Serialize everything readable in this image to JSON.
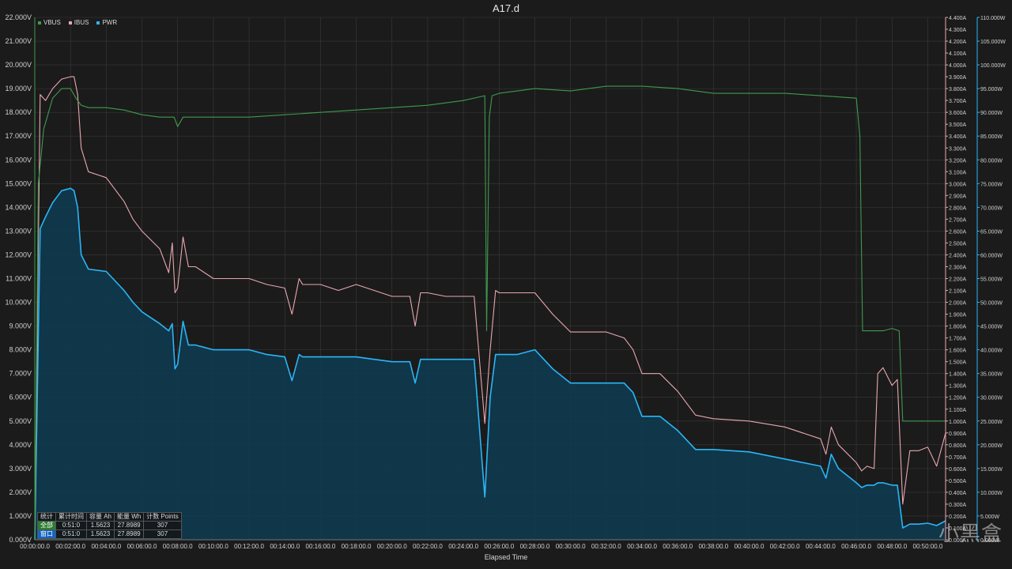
{
  "chart_data": {
    "type": "line",
    "title": "A17.d",
    "xlabel": "Elapsed Time",
    "x_unit": "minutes",
    "xlim": [
      0,
      51
    ],
    "x_tick_labels": [
      "00:00:00.0",
      "00:02:00.0",
      "00:04:00.0",
      "00:06:00.0",
      "00:08:00.0",
      "00:10:00.0",
      "00:12:00.0",
      "00:14:00.0",
      "00:16:00.0",
      "00:18:00.0",
      "00:20:00.0",
      "00:22:00.0",
      "00:24:00.0",
      "00:26:00.0",
      "00:28:00.0",
      "00:30:00.0",
      "00:32:00.0",
      "00:34:00.0",
      "00:36:00.0",
      "00:38:00.0",
      "00:40:00.0",
      "00:42:00.0",
      "00:44:00.0",
      "00:46:00.0",
      "00:48:00.0",
      "00:50:00.0"
    ],
    "axes": {
      "left": {
        "series": "VBUS",
        "ylim": [
          0,
          22
        ],
        "tick_step": 1,
        "tick_labels": [
          "0.000V",
          "1.000V",
          "2.000V",
          "3.000V",
          "4.000V",
          "5.000V",
          "6.000V",
          "7.000V",
          "8.000V",
          "9.000V",
          "10.000V",
          "11.000V",
          "12.000V",
          "13.000V",
          "14.000V",
          "15.000V",
          "16.000V",
          "17.000V",
          "18.000V",
          "19.000V",
          "20.000V",
          "21.000V",
          "22.000V"
        ]
      },
      "right1": {
        "series": "IBUS",
        "ylim": [
          0,
          4.4
        ],
        "tick_step": 0.1,
        "tick_labels": [
          "0.000A",
          "0.100A",
          "0.200A",
          "0.300A",
          "0.400A",
          "0.500A",
          "0.600A",
          "0.700A",
          "0.800A",
          "0.900A",
          "1.000A",
          "1.100A",
          "1.200A",
          "1.300A",
          "1.400A",
          "1.500A",
          "1.600A",
          "1.700A",
          "1.800A",
          "1.900A",
          "2.000A",
          "2.100A",
          "2.200A",
          "2.300A",
          "2.400A",
          "2.500A",
          "2.600A",
          "2.700A",
          "2.800A",
          "2.900A",
          "3.000A",
          "3.100A",
          "3.200A",
          "3.300A",
          "3.400A",
          "3.500A",
          "3.600A",
          "3.700A",
          "3.800A",
          "3.900A",
          "4.000A",
          "4.100A",
          "4.200A",
          "4.300A",
          "4.400A"
        ]
      },
      "right2": {
        "series": "PWR",
        "ylim": [
          0,
          110
        ],
        "tick_step": 5,
        "tick_labels": [
          "0.000W",
          "5.000W",
          "10.000W",
          "15.000W",
          "20.000W",
          "25.000W",
          "30.000W",
          "35.000W",
          "40.000W",
          "45.000W",
          "50.000W",
          "55.000W",
          "60.000W",
          "65.000W",
          "70.000W",
          "75.000W",
          "80.000W",
          "85.000W",
          "90.000W",
          "95.000W",
          "100.000W",
          "105.000W",
          "110.000W"
        ]
      }
    },
    "grid": true,
    "legend_position": "top-left",
    "series": [
      {
        "name": "VBUS",
        "unit": "V",
        "axis": "left",
        "color": "#3f9a4e",
        "x": [
          0,
          0.2,
          0.5,
          1,
          1.5,
          2,
          2.3,
          2.6,
          3,
          4,
          5,
          6,
          7,
          7.8,
          8,
          8.3,
          8.8,
          10,
          12,
          14,
          16,
          18,
          20,
          22,
          24,
          25.2,
          25.3,
          25.45,
          25.6,
          26,
          28,
          30,
          32,
          34,
          36,
          37,
          38,
          40,
          42,
          44,
          46,
          46.2,
          46.35,
          46.5,
          47.5,
          48,
          48.4,
          48.6,
          50,
          51
        ],
        "y": [
          0,
          15,
          17.3,
          18.6,
          19,
          19,
          18.6,
          18.3,
          18.2,
          18.2,
          18.1,
          17.9,
          17.8,
          17.8,
          17.4,
          17.8,
          17.8,
          17.8,
          17.8,
          17.9,
          18,
          18.1,
          18.2,
          18.3,
          18.5,
          18.7,
          8.8,
          17.8,
          18.7,
          18.8,
          19.0,
          18.9,
          19.1,
          19.1,
          19.0,
          18.9,
          18.8,
          18.8,
          18.8,
          18.7,
          18.6,
          17.0,
          8.8,
          8.8,
          8.8,
          8.9,
          8.8,
          5.0,
          5.0,
          5.0
        ]
      },
      {
        "name": "IBUS",
        "unit": "A",
        "axis": "right1",
        "color": "#e8a7b0",
        "x": [
          0,
          0.3,
          0.6,
          1,
          1.5,
          2,
          2.2,
          2.4,
          2.6,
          3,
          4,
          4.5,
          5,
          5.5,
          6,
          7,
          7.5,
          7.7,
          7.85,
          8,
          8.3,
          8.6,
          9,
          10,
          11,
          12,
          13,
          14,
          14.4,
          14.8,
          15,
          16,
          17,
          18,
          19,
          20,
          21,
          21.3,
          21.6,
          22,
          23,
          24,
          24.6,
          25.2,
          25.5,
          25.8,
          26,
          27,
          28,
          29,
          30,
          32,
          33,
          33.5,
          34,
          35,
          36,
          37,
          38,
          40,
          42,
          44,
          44.3,
          44.6,
          45,
          46,
          46.3,
          46.6,
          47,
          47.2,
          47.5,
          48,
          48.3,
          48.6,
          49,
          49.5,
          50,
          50.5,
          51
        ],
        "y": [
          0,
          3.75,
          3.7,
          3.8,
          3.88,
          3.9,
          3.9,
          3.75,
          3.3,
          3.1,
          3.05,
          2.95,
          2.85,
          2.7,
          2.6,
          2.45,
          2.25,
          2.5,
          2.08,
          2.12,
          2.55,
          2.3,
          2.3,
          2.2,
          2.2,
          2.2,
          2.15,
          2.12,
          1.9,
          2.2,
          2.15,
          2.15,
          2.1,
          2.15,
          2.1,
          2.05,
          2.05,
          1.8,
          2.08,
          2.08,
          2.05,
          2.05,
          2.05,
          0.98,
          1.6,
          2.1,
          2.08,
          2.08,
          2.08,
          1.9,
          1.75,
          1.75,
          1.7,
          1.6,
          1.4,
          1.4,
          1.25,
          1.05,
          1.02,
          1.0,
          0.95,
          0.85,
          0.72,
          0.95,
          0.8,
          0.65,
          0.58,
          0.62,
          0.6,
          1.4,
          1.45,
          1.3,
          1.35,
          0.3,
          0.75,
          0.75,
          0.78,
          0.62,
          0.9
        ]
      },
      {
        "name": "PWR",
        "unit": "W",
        "axis": "right2",
        "color": "#29b6f6",
        "x": [
          0,
          0.3,
          0.6,
          1,
          1.5,
          2,
          2.2,
          2.4,
          2.6,
          3,
          4,
          4.5,
          5,
          5.5,
          6,
          7,
          7.5,
          7.7,
          7.85,
          8,
          8.3,
          8.6,
          9,
          10,
          11,
          12,
          13,
          14,
          14.4,
          14.8,
          15,
          16,
          17,
          18,
          19,
          20,
          21,
          21.3,
          21.6,
          22,
          23,
          24,
          24.6,
          25.2,
          25.5,
          25.8,
          26,
          27,
          28,
          29,
          30,
          32,
          33,
          33.5,
          34,
          35,
          36,
          37,
          38,
          40,
          42,
          44,
          44.3,
          44.6,
          45,
          46,
          46.3,
          46.6,
          47,
          47.2,
          47.5,
          48,
          48.3,
          48.6,
          49,
          49.5,
          50,
          50.5,
          51
        ],
        "y": [
          0,
          65.5,
          68,
          71,
          73.5,
          74,
          73.5,
          70,
          60,
          57,
          56.5,
          54.5,
          52.5,
          50,
          48,
          45.5,
          44,
          45.5,
          36,
          37,
          46,
          41,
          41,
          40,
          40,
          40,
          39,
          38.5,
          33.5,
          39,
          38.5,
          38.5,
          38.5,
          38.5,
          38,
          37.5,
          37.5,
          33,
          38,
          38,
          38,
          38,
          38,
          9,
          30,
          39,
          39,
          39,
          40,
          36,
          33,
          33,
          33,
          31,
          26,
          26,
          23,
          19,
          19,
          18.5,
          17,
          15.5,
          13,
          18,
          15,
          12,
          11,
          11.5,
          11.5,
          12,
          12,
          11.5,
          11.5,
          2.5,
          3.3,
          3.3,
          3.5,
          3,
          4
        ]
      }
    ],
    "stats_table": {
      "headers": [
        "统计",
        "累计时间",
        "容量 Ah",
        "能量 Wh",
        "计数 Points"
      ],
      "rows": [
        {
          "label": "全部",
          "time": "0:51:0",
          "capacity": "1.5623",
          "energy": "27.8989",
          "points": "307"
        },
        {
          "label": "窗口",
          "time": "0:51:0",
          "capacity": "1.5623",
          "energy": "27.8989",
          "points": "307"
        }
      ]
    }
  },
  "watermark": "小黑盒",
  "colors": {
    "background": "#1b1b1b",
    "grid": "#3a3a3a",
    "axis_text": "#d0d0d0",
    "pwr_fill": "#0e3b52"
  }
}
